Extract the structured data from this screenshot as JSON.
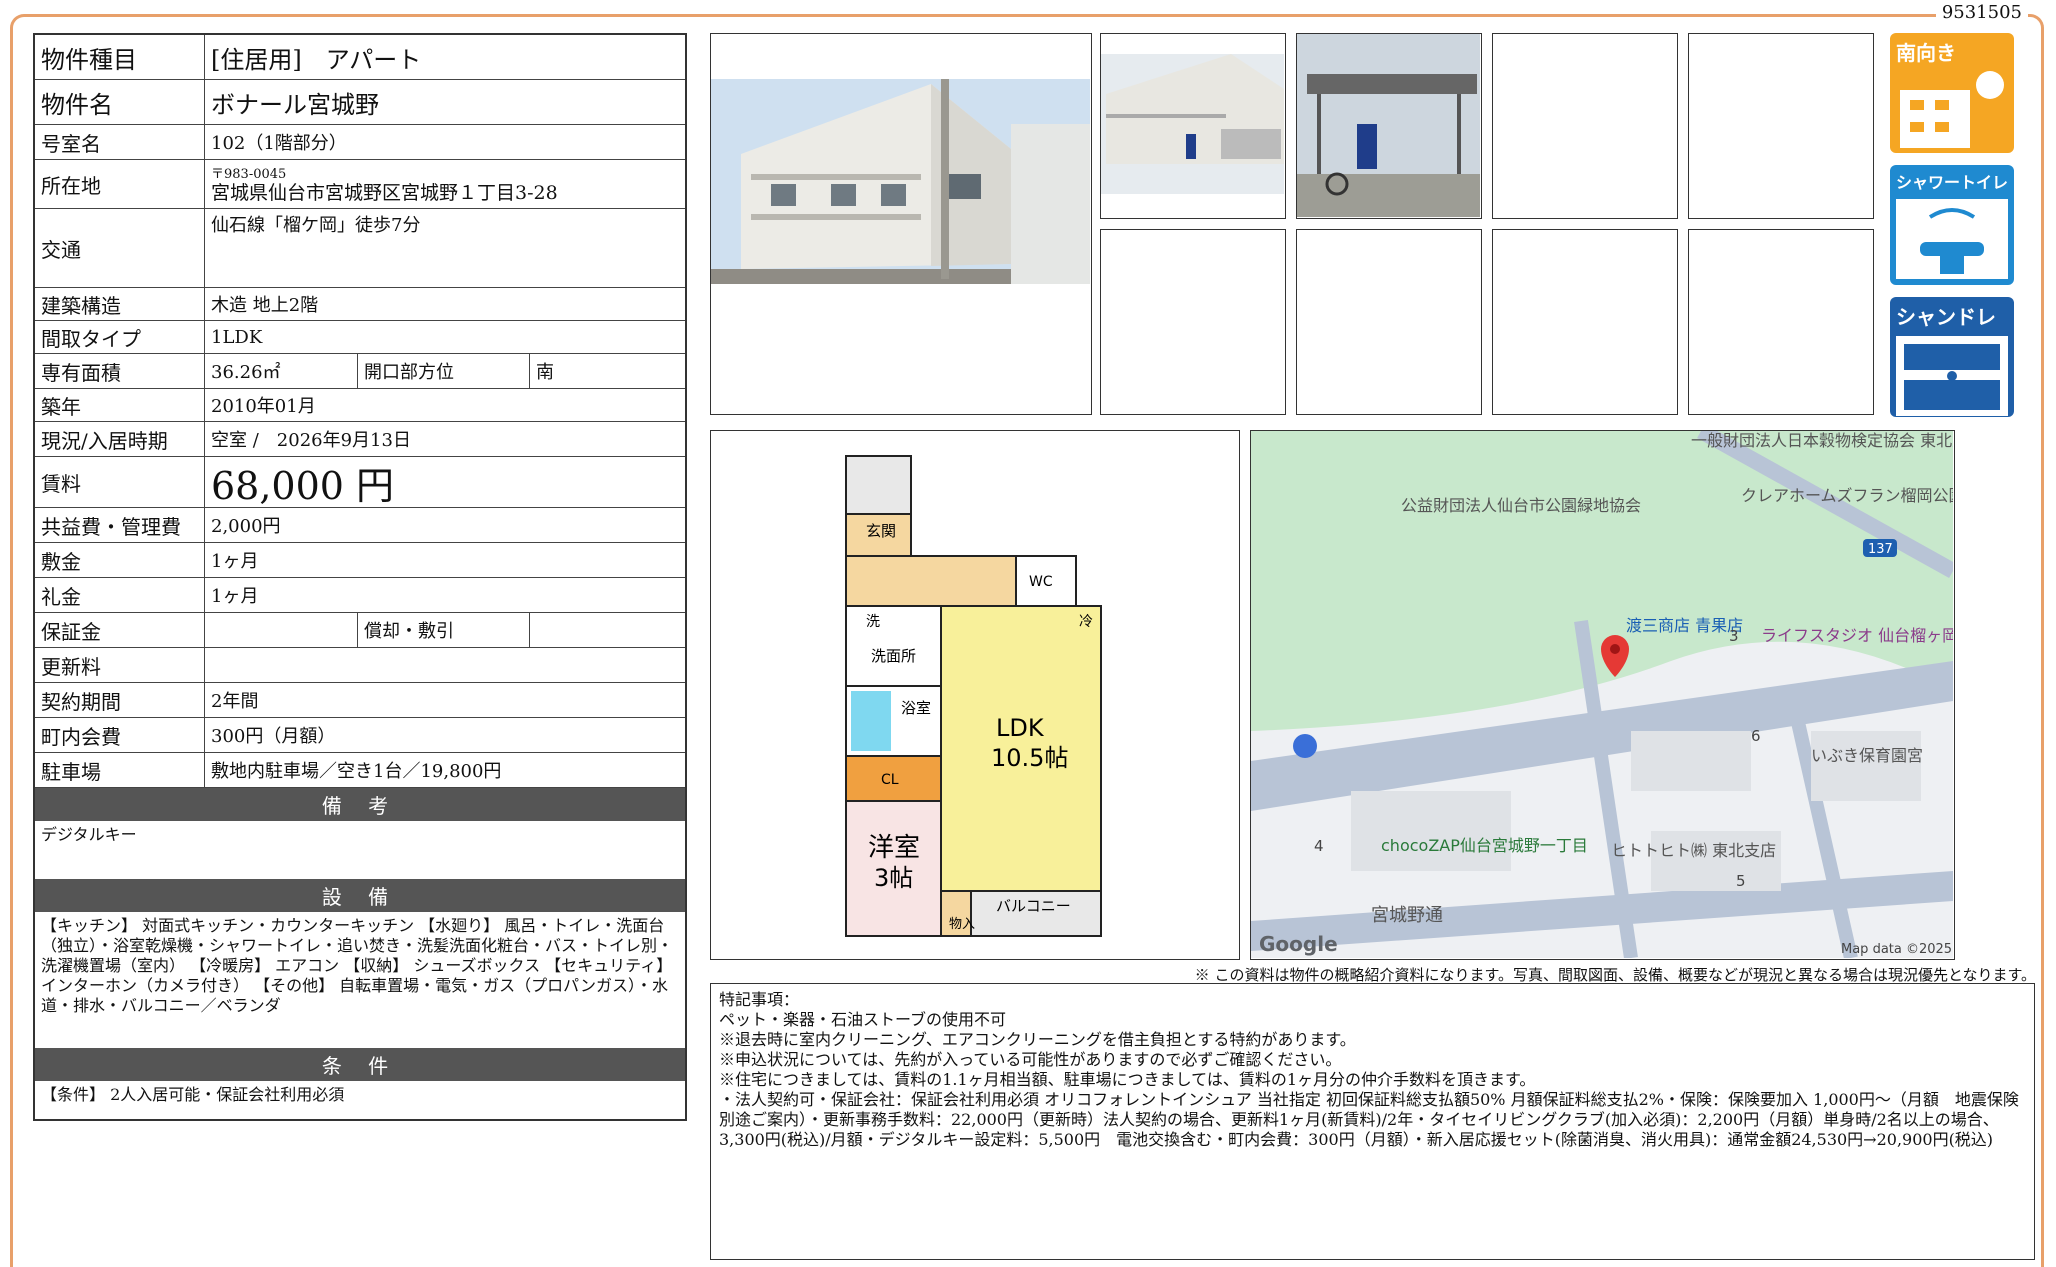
{
  "property_id": "9531505",
  "rows": {
    "type": {
      "label": "物件種目",
      "value": "[住居用]　アパート"
    },
    "name": {
      "label": "物件名",
      "value": "ボナール宮城野"
    },
    "room": {
      "label": "号室名",
      "value": "102（1階部分）"
    },
    "address": {
      "label": "所在地",
      "postal": "〒983-0045",
      "value": "宮城県仙台市宮城野区宮城野１丁目3-28"
    },
    "access": {
      "label": "交通",
      "value": "仙石線「榴ケ岡」徒歩7分"
    },
    "structure": {
      "label": "建築構造",
      "value": "木造 地上2階"
    },
    "layout": {
      "label": "間取タイプ",
      "value": "1LDK"
    },
    "area": {
      "label": "専有面積",
      "value": "36.26㎡",
      "sub_label": "開口部方位",
      "sub_value": "南"
    },
    "built": {
      "label": "築年",
      "value": "2010年01月"
    },
    "status": {
      "label": "現況/入居時期",
      "value": "空室 /　2026年9月13日"
    },
    "rent": {
      "label": "賃料",
      "value": "68,000 円"
    },
    "common": {
      "label": "共益費・管理費",
      "value": "2,000円"
    },
    "deposit": {
      "label": "敷金",
      "value": "1ヶ月"
    },
    "key_money": {
      "label": "礼金",
      "value": "1ヶ月"
    },
    "guarantee": {
      "label": "保証金",
      "value": "",
      "sub_label": "償却・敷引",
      "sub_value": ""
    },
    "renewal": {
      "label": "更新料",
      "value": ""
    },
    "contract": {
      "label": "契約期間",
      "value": "2年間"
    },
    "town_fee": {
      "label": "町内会費",
      "value": "300円（月額）"
    },
    "parking": {
      "label": "駐車場",
      "value": "敷地内駐車場／空き1台／19,800円"
    }
  },
  "sections": {
    "remarks": {
      "title": "備 考",
      "text": "デジタルキー"
    },
    "equipment": {
      "title": "設 備",
      "text": "【キッチン】 対面式キッチン・カウンターキッチン 【水廻り】 風呂・トイレ・洗面台（独立）・浴室乾燥機・シャワートイレ・追い焚き・洗髪洗面化粧台・バス・トイレ別・洗濯機置場（室内） 【冷暖房】 エアコン 【収納】 シューズボックス 【セキュリティ】 インターホン（カメラ付き） 【その他】 自転車置場・電気・ガス（プロパンガス）・水道・排水・バルコニー／ベランダ"
    },
    "conditions": {
      "title": "条 件",
      "text": "【条件】 2人入居可能・保証会社利用必須"
    }
  },
  "badges": [
    "南向き",
    "シャワートイレ",
    "シャンドレ"
  ],
  "floorplan": {
    "rooms": {
      "entrance": "玄関",
      "wc": "WC",
      "wash": "洗",
      "washroom": "洗面所",
      "fridge": "冷",
      "bath": "浴室",
      "closet": "CL",
      "bedroom_name": "洋室",
      "bedroom_size": "3帖",
      "storage": "物入",
      "ldk_name": "LDK",
      "ldk_size": "10.5帖",
      "balcony": "バルコニー"
    }
  },
  "map": {
    "labels": [
      "一般財団法人日本穀物検定協会 東北支部",
      "公益財団法人仙台市公園緑地協会",
      "クレアホームズフラン榴岡公園",
      "137",
      "渡三商店 青果店",
      "ライフスタジオ 仙台榴ヶ岡店",
      "いぶき保育園宮",
      "chocoZAP仙台宮城野一丁目",
      "ヒトトヒト㈱ 東北支店",
      "宮城野通",
      "3",
      "6",
      "4",
      "5"
    ],
    "logo": "Google",
    "credit": "Map data ©2025"
  },
  "disclaimer": "※ この資料は物件の概略紹介資料になります。写真、間取図面、設備、概要などが現況と異なる場合は現況優先となります。",
  "notes": [
    "特記事項：",
    "ペット・楽器・石油ストーブの使用不可",
    "※退去時に室内クリーニング、エアコンクリーニングを借主負担とする特約があります。",
    "※申込状況については、先約が入っている可能性がありますので必ずご確認ください。",
    "※住宅につきましては、賃料の1.1ヶ月相当額、駐車場につきましては、賃料の1ヶ月分の仲介手数料を頂きます。",
    "・法人契約可・保証会社：保証会社利用必須 オリコフォレントインシュア 当社指定 初回保証料総支払額50% 月額保証料総支払2%・保険：保険要加入 1,000円～（月額　地震保険別途ご案内）・更新事務手数料：22,000円（更新時）法人契約の場合、更新料1ヶ月(新賃料)/2年・タイセイリビングクラブ(加入必須)：2,200円（月額）単身時/2名以上の場合、3,300円(税込)/月額・デジタルキー設定料：5,500円　電池交換含む・町内会費：300円（月額）・新入居応援セット(除菌消臭、消火用具)：通常金額24,530円→20,900円(税込)"
  ]
}
